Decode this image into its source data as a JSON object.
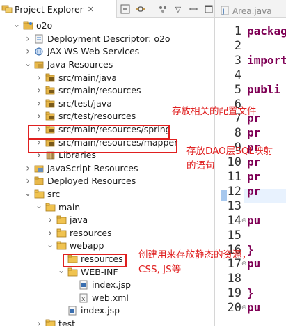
{
  "explorer": {
    "tab_title": "Project Explorer",
    "close_glyph": "✕",
    "toolbar": [
      "collapse-all-icon",
      "link-with-editor-icon",
      "filter-icon",
      "view-menu-icon",
      "minimize-icon",
      "maximize-icon"
    ]
  },
  "tree": [
    {
      "label": "o2o",
      "icon": "project-icon",
      "arrow": "open"
    },
    {
      "label": "Deployment Descriptor: o2o",
      "icon": "descriptor-icon",
      "arrow": "closed"
    },
    {
      "label": "JAX-WS Web Services",
      "icon": "webservices-icon",
      "arrow": "closed"
    },
    {
      "label": "Java Resources",
      "icon": "java-resources-icon",
      "arrow": "open"
    },
    {
      "label": "src/main/java",
      "icon": "source-folder-icon",
      "arrow": "closed"
    },
    {
      "label": "src/main/resources",
      "icon": "source-folder-icon",
      "arrow": "closed"
    },
    {
      "label": "src/test/java",
      "icon": "source-folder-icon",
      "arrow": "closed"
    },
    {
      "label": "src/test/resources",
      "icon": "source-folder-icon",
      "arrow": "closed"
    },
    {
      "label": "src/main/resources/spring",
      "icon": "source-folder-icon",
      "arrow": "closed"
    },
    {
      "label": "src/main/resources/mapper",
      "icon": "source-folder-icon",
      "arrow": "closed"
    },
    {
      "label": "Libraries",
      "icon": "libraries-icon",
      "arrow": "closed"
    },
    {
      "label": "JavaScript Resources",
      "icon": "javascript-resources-icon",
      "arrow": "closed"
    },
    {
      "label": "Deployed Resources",
      "icon": "deployed-resources-icon",
      "arrow": "closed"
    },
    {
      "label": "src",
      "icon": "folder-icon",
      "arrow": "open"
    },
    {
      "label": "main",
      "icon": "folder-icon",
      "arrow": "open"
    },
    {
      "label": "java",
      "icon": "folder-icon",
      "arrow": "closed"
    },
    {
      "label": "resources",
      "icon": "folder-icon",
      "arrow": "closed"
    },
    {
      "label": "webapp",
      "icon": "folder-icon",
      "arrow": "open"
    },
    {
      "label": "resources",
      "icon": "folder-icon",
      "arrow": "none"
    },
    {
      "label": "WEB-INF",
      "icon": "folder-icon",
      "arrow": "open"
    },
    {
      "label": "index.jsp",
      "icon": "jsp-file-icon",
      "arrow": "none"
    },
    {
      "label": "web.xml",
      "icon": "xml-file-icon",
      "arrow": "none"
    },
    {
      "label": "index.jsp",
      "icon": "jsp-file-icon",
      "arrow": "none"
    },
    {
      "label": "test",
      "icon": "folder-icon",
      "arrow": "closed"
    }
  ],
  "editor": {
    "tab_title": "Area.java",
    "lines": [
      {
        "num": "1",
        "code": "packag",
        "fold": ""
      },
      {
        "num": "2",
        "code": "",
        "fold": ""
      },
      {
        "num": "3",
        "code": "import",
        "fold": ""
      },
      {
        "num": "4",
        "code": "",
        "fold": ""
      },
      {
        "num": "5",
        "code": "publi",
        "fold": ""
      },
      {
        "num": "6",
        "code": "",
        "fold": ""
      },
      {
        "num": "7",
        "code": "pr",
        "fold": ""
      },
      {
        "num": "8",
        "code": "pr",
        "fold": ""
      },
      {
        "num": "9",
        "code": "pr",
        "fold": ""
      },
      {
        "num": "10",
        "code": "pr",
        "fold": ""
      },
      {
        "num": "11",
        "code": "pr",
        "fold": ""
      },
      {
        "num": "12",
        "code": "pr",
        "fold": ""
      },
      {
        "num": "13",
        "code": "",
        "fold": ""
      },
      {
        "num": "14",
        "code": "pu",
        "fold": "⊖"
      },
      {
        "num": "15",
        "code": "",
        "fold": ""
      },
      {
        "num": "16",
        "code": "}",
        "fold": ""
      },
      {
        "num": "17",
        "code": "pu",
        "fold": "⊖"
      },
      {
        "num": "18",
        "code": "",
        "fold": ""
      },
      {
        "num": "19",
        "code": "}",
        "fold": ""
      },
      {
        "num": "20",
        "code": "pu",
        "fold": "⊖"
      }
    ]
  },
  "annotations": {
    "note1": "存放相关的配置文件",
    "note2_line1": "存放DAO层SQL映射",
    "note2_line2": "的语句",
    "note3_line1": "创建用来存放静态的资源，",
    "note3_line2": "CSS, JS等"
  },
  "colors": {
    "annotation": "#e02020",
    "keyword": "#7f0055",
    "folder": "#e8b84a"
  }
}
